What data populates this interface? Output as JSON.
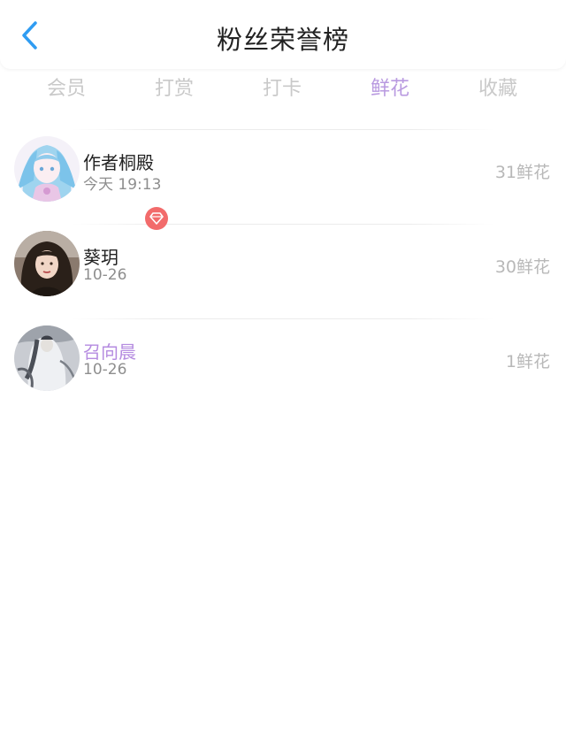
{
  "header": {
    "title": "粉丝荣誉榜",
    "back_icon": "chevron-left-icon",
    "accent_color": "#2f9cf2"
  },
  "tabs": [
    {
      "label": "会员",
      "active": false
    },
    {
      "label": "打赏",
      "active": false
    },
    {
      "label": "打卡",
      "active": false
    },
    {
      "label": "鲜花",
      "active": true
    },
    {
      "label": "收藏",
      "active": false
    }
  ],
  "active_tab_color": "#b99ae0",
  "fans": [
    {
      "name": "作者桐殿",
      "date": "今天 19:13",
      "count": "31鲜花",
      "avatar": "anime-girl-avatar",
      "vip": false
    },
    {
      "name": "葵玥",
      "date": "10-26",
      "count": "30鲜花",
      "avatar": "woman-photo-avatar",
      "vip": false
    },
    {
      "name": "召向晨",
      "date": "10-26",
      "count": "1鲜花",
      "avatar": "ink-painting-avatar",
      "vip": true,
      "badge_icon": "diamond-icon",
      "badge_color": "#f26b6b"
    }
  ]
}
